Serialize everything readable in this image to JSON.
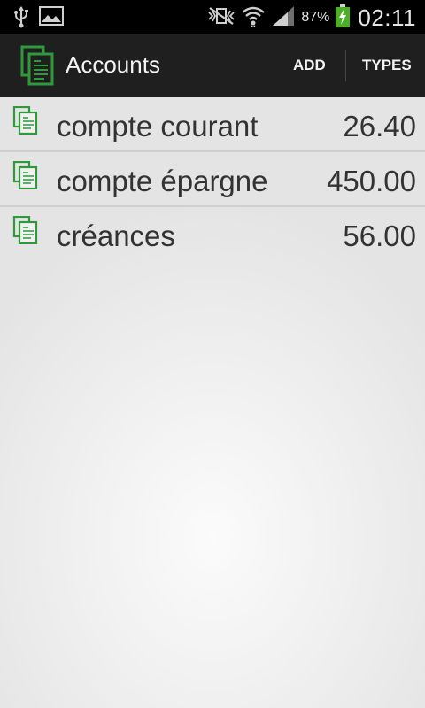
{
  "status_bar": {
    "battery_percent": "87%",
    "time": "02:11",
    "icons": [
      "usb-icon",
      "image-icon",
      "vibrate-mute-icon",
      "wifi-icon",
      "signal-icon",
      "battery-charging-icon"
    ]
  },
  "action_bar": {
    "title": "Accounts",
    "add_label": "ADD",
    "types_label": "TYPES",
    "icon": "accounts-icon"
  },
  "accounts": [
    {
      "name": "compte courant",
      "amount": "26.40"
    },
    {
      "name": "compte épargne",
      "amount": "450.00"
    },
    {
      "name": "créances",
      "amount": "56.00"
    }
  ],
  "colors": {
    "accent": "#2e9a3a",
    "action_bar_bg": "#1f1f1f",
    "text": "#333333"
  }
}
